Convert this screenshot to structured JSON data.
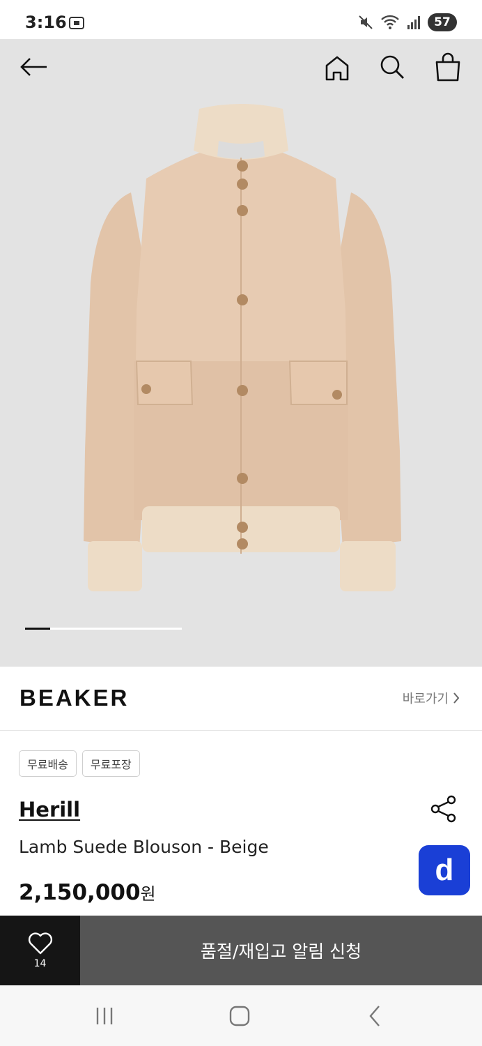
{
  "status_bar": {
    "time": "3:16",
    "battery": "57",
    "icons": [
      "screenshot-icon",
      "mute-icon",
      "wifi-icon",
      "signal-icon",
      "battery-icon"
    ]
  },
  "header": {
    "back_icon": "arrow-left-icon",
    "home_icon": "home-icon",
    "search_icon": "search-icon",
    "cart_icon": "shopping-bag-icon"
  },
  "gallery": {
    "position": 0.16
  },
  "brand_bar": {
    "logo": "BEAKER",
    "link_label": "바로가기"
  },
  "product": {
    "tags": [
      "무료배송",
      "무료포장"
    ],
    "brand": "Herill",
    "name": "Lamb Suede Blouson - Beige",
    "price": "2,150,000",
    "price_unit": "원"
  },
  "fab_label": "d",
  "action_bar": {
    "wish_count": "14",
    "restock_label": "품절/재입고 알림 신청"
  },
  "colors": {
    "hero_bg": "#e3e3e3",
    "jacket": "#e5c8ae",
    "fab": "#1a3fd6",
    "restock_bg": "#555555",
    "wish_bg": "#151515"
  }
}
